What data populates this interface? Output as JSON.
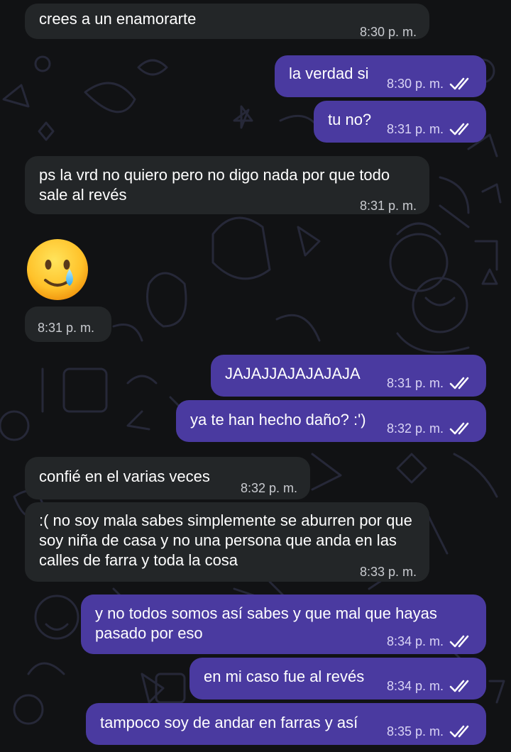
{
  "messages": [
    {
      "id": "m1",
      "dir": "in",
      "text": "crees a un enamorarte",
      "time": "8:30 p. m."
    },
    {
      "id": "m2",
      "dir": "out",
      "text": "la verdad si",
      "time": "8:30 p. m."
    },
    {
      "id": "m3",
      "dir": "out",
      "text": "tu no?",
      "time": "8:31 p. m."
    },
    {
      "id": "m4",
      "dir": "in",
      "text": "ps la vrd no quiero pero no digo nada por que todo sale al revés",
      "time": "8:31 p. m."
    },
    {
      "id": "m5",
      "dir": "in",
      "emoji": "smiling-face-with-tear",
      "time": "8:31 p. m."
    },
    {
      "id": "m6",
      "dir": "out",
      "text": "JAJAJJAJAJAJAJA",
      "time": "8:31 p. m."
    },
    {
      "id": "m7",
      "dir": "out",
      "text": "ya te han hecho daño? :')",
      "time": "8:32 p. m."
    },
    {
      "id": "m8",
      "dir": "in",
      "text": "confié en el varias veces",
      "time": "8:32 p. m."
    },
    {
      "id": "m9",
      "dir": "in",
      "text": ":( no soy mala sabes simplemente se aburren por que soy niña de casa y no una persona que anda en las calles de farra y toda la cosa",
      "time": "8:33 p. m."
    },
    {
      "id": "m10",
      "dir": "out",
      "text": "y no todos somos así sabes y que mal que hayas pasado por eso",
      "time": "8:34 p. m."
    },
    {
      "id": "m11",
      "dir": "out",
      "text": "en mi caso fue al revés",
      "time": "8:34 p. m."
    },
    {
      "id": "m12",
      "dir": "out",
      "text": "tampoco soy de andar en farras y así",
      "time": "8:35 p. m."
    }
  ],
  "colors": {
    "background": "#111214",
    "incoming_bubble": "#232628",
    "outgoing_bubble": "#4a3aa0",
    "wallpaper_doodle": "#2a2c40"
  }
}
